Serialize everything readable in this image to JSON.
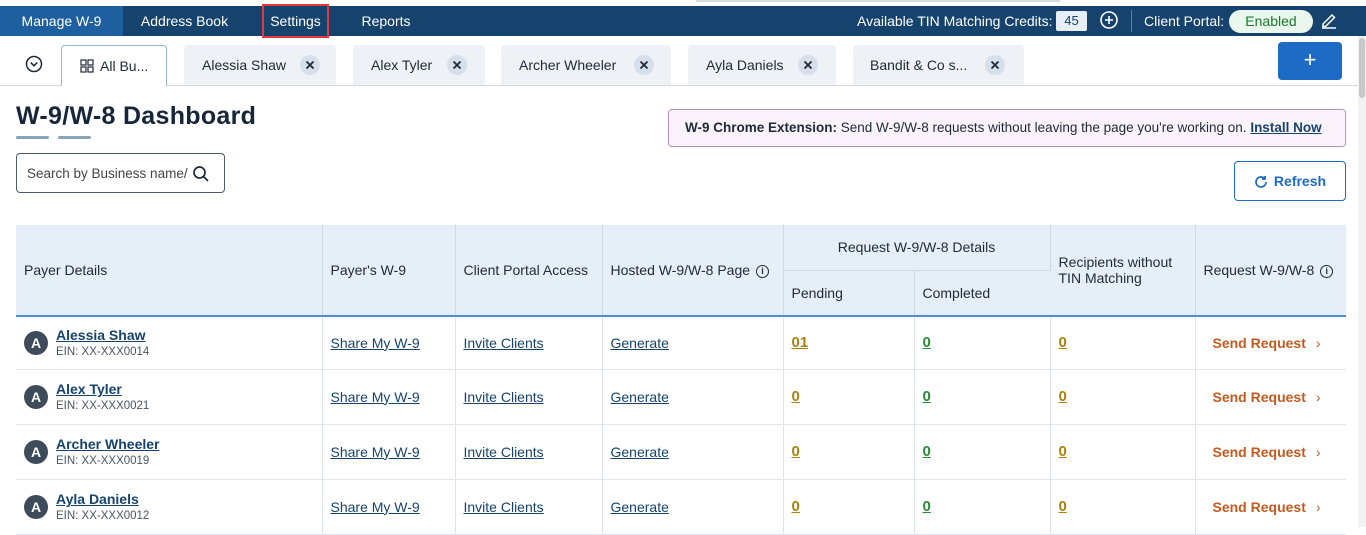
{
  "nav": {
    "items": [
      {
        "label": "Manage W-9"
      },
      {
        "label": "Address Book"
      },
      {
        "label": "Settings"
      },
      {
        "label": "Reports"
      }
    ],
    "credits_label": "Available TIN Matching Credits:",
    "credits_value": "45",
    "portal_label": "Client Portal:",
    "portal_status": "Enabled"
  },
  "tabs": [
    {
      "label": "All Bu..."
    },
    {
      "label": "Alessia Shaw"
    },
    {
      "label": "Alex Tyler"
    },
    {
      "label": "Archer Wheeler"
    },
    {
      "label": "Ayla Daniels"
    },
    {
      "label": "Bandit & Co s..."
    }
  ],
  "add_tab_label": "+",
  "page": {
    "title": "W-9/W-8 Dashboard",
    "search_placeholder": "Search by Business name/",
    "banner_bold": "W-9 Chrome Extension:",
    "banner_text": " Send W-9/W-8 requests without leaving the page you're working on. ",
    "banner_link": "Install Now",
    "refresh_label": "Refresh"
  },
  "table": {
    "headers": {
      "payer": "Payer Details",
      "payer_w9": "Payer's W-9",
      "portal": "Client Portal Access",
      "hosted": "Hosted W-9/W-8 Page",
      "request_details": "Request W-9/W-8 Details",
      "pending": "Pending",
      "completed": "Completed",
      "recipients": "Recipients without TIN Matching",
      "request": "Request W-9/W-8"
    },
    "rows": [
      {
        "initial": "A",
        "name": "Alessia Shaw",
        "ein": "EIN: XX-XXX0014",
        "w9": "Share My W-9",
        "portal": "Invite Clients",
        "hosted": "Generate",
        "pending": "01",
        "completed": "0",
        "recipients": "0",
        "action": "Send Request"
      },
      {
        "initial": "A",
        "name": "Alex Tyler",
        "ein": "EIN: XX-XXX0021",
        "w9": "Share My W-9",
        "portal": "Invite Clients",
        "hosted": "Generate",
        "pending": "0",
        "completed": "0",
        "recipients": "0",
        "action": "Send Request"
      },
      {
        "initial": "A",
        "name": "Archer Wheeler",
        "ein": "EIN: XX-XXX0019",
        "w9": "Share My W-9",
        "portal": "Invite Clients",
        "hosted": "Generate",
        "pending": "0",
        "completed": "0",
        "recipients": "0",
        "action": "Send Request"
      },
      {
        "initial": "A",
        "name": "Ayla Daniels",
        "ein": "EIN: XX-XXX0012",
        "w9": "Share My W-9",
        "portal": "Invite Clients",
        "hosted": "Generate",
        "pending": "0",
        "completed": "0",
        "recipients": "0",
        "action": "Send Request"
      }
    ]
  },
  "colors": {
    "nav_bg": "#16436e",
    "accent": "#1d6bc4",
    "action": "#c55a1e",
    "pending": "#a9820f",
    "completed": "#2e8b3a"
  }
}
